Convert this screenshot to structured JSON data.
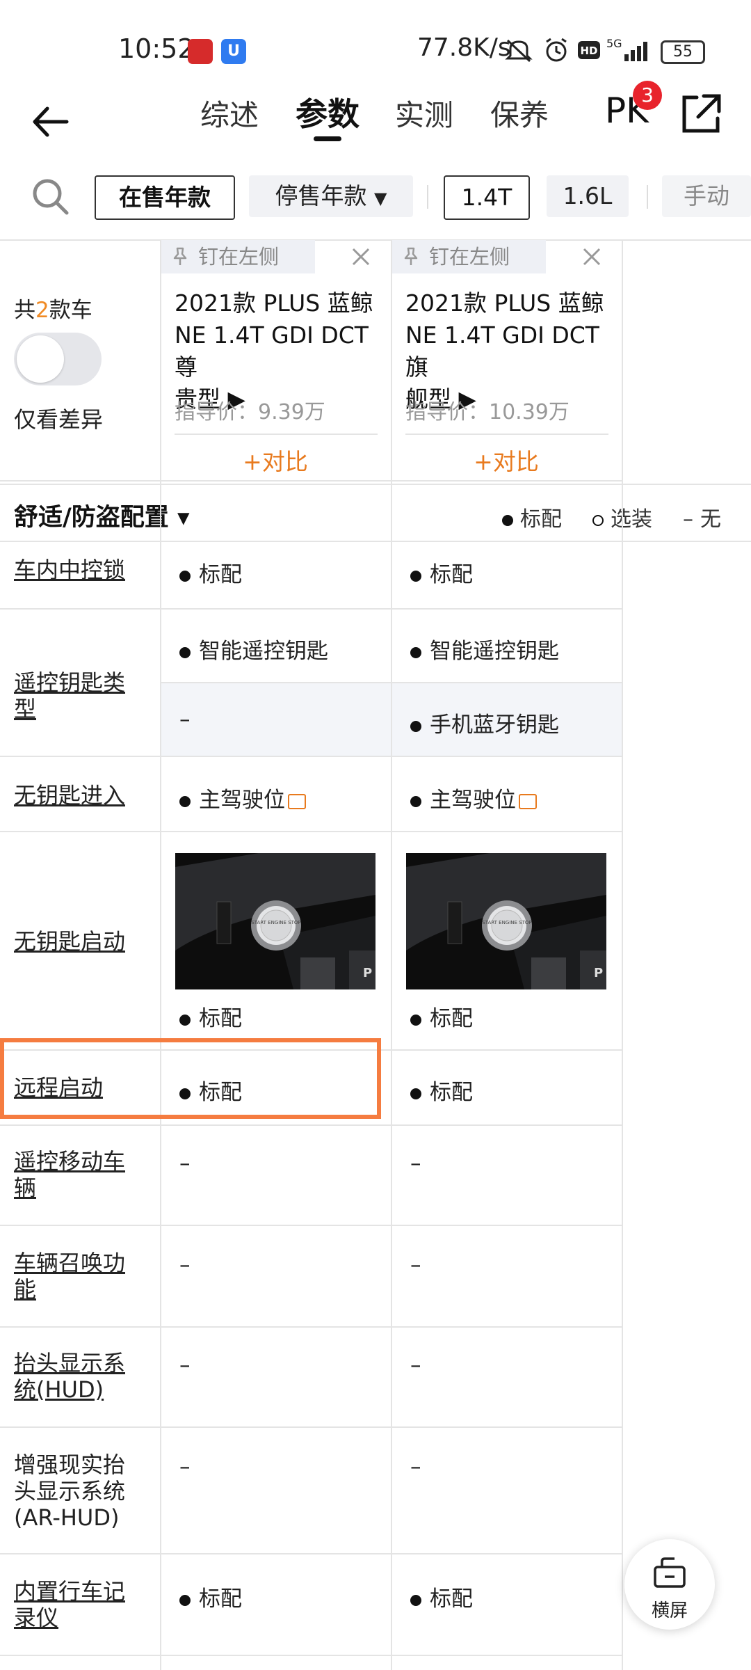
{
  "status_bar": {
    "time": "10:52",
    "net_speed": "77.8K/s",
    "network": "5G",
    "battery": "55"
  },
  "nav": {
    "tabs": [
      "综述",
      "参数",
      "实测",
      "保养"
    ],
    "active_tab": "参数",
    "pk_label": "PK",
    "pk_count": "3"
  },
  "filters": {
    "chips": [
      "在售年款",
      "停售年款",
      "1.4T",
      "1.6L",
      "手动"
    ]
  },
  "compare": {
    "count_prefix": "共",
    "count": "2",
    "count_suffix": "款车",
    "diff_only_label": "仅看差异",
    "pin_label": "钉在左侧",
    "add_label": "+对比",
    "cars": [
      {
        "name_line1": "2021款 PLUS 蓝鲸",
        "name_line2": "NE 1.4T GDI DCT尊",
        "name_line3": "贵型 ▶",
        "price": "指导价：9.39万"
      },
      {
        "name_line1": "2021款 PLUS 蓝鲸",
        "name_line2": "NE 1.4T GDI DCT旗",
        "name_line3": "舰型 ▶",
        "price": "指导价：10.39万"
      }
    ]
  },
  "section": {
    "title": "舒适/防盗配置 ▾",
    "legend_std": "标配",
    "legend_opt": "选装",
    "legend_none": "无"
  },
  "rows": {
    "r1": {
      "label": "车内中控锁",
      "c1": "标配",
      "c2": "标配"
    },
    "r2": {
      "label": "遥控钥匙类型",
      "c1a": "智能遥控钥匙",
      "c2a": "智能遥控钥匙",
      "c1b": "–",
      "c2b": "手机蓝牙钥匙"
    },
    "r3": {
      "label": "无钥匙进入",
      "c1": "主驾驶位",
      "c2": "主驾驶位"
    },
    "r4": {
      "label": "无钥匙启动",
      "c1": "标配",
      "c2": "标配",
      "photo_text": "START ENGINE STOP"
    },
    "r5": {
      "label": "远程启动",
      "c1": "标配",
      "c2": "标配"
    },
    "r6": {
      "label_l1": "遥控移动车",
      "label_l2": "辆",
      "c1": "–",
      "c2": "–"
    },
    "r7": {
      "label_l1": "车辆召唤功",
      "label_l2": "能",
      "c1": "–",
      "c2": "–"
    },
    "r8": {
      "label_l1": "抬头显示系",
      "label_l2": "统(HUD)",
      "c1": "–",
      "c2": "–"
    },
    "r9": {
      "label_l1": "增强现实抬",
      "label_l2": "头显示系统",
      "label_l3": "(AR-HUD)",
      "c1": "–",
      "c2": "–"
    },
    "r10": {
      "label_l1": "内置行车记",
      "label_l2": "录仪",
      "c1": "标配",
      "c2": "标配"
    }
  },
  "fab": {
    "label": "横屏"
  },
  "colors": {
    "accent": "#e87a1e",
    "highlight": "#f57c40",
    "badge": "#e8232c"
  }
}
